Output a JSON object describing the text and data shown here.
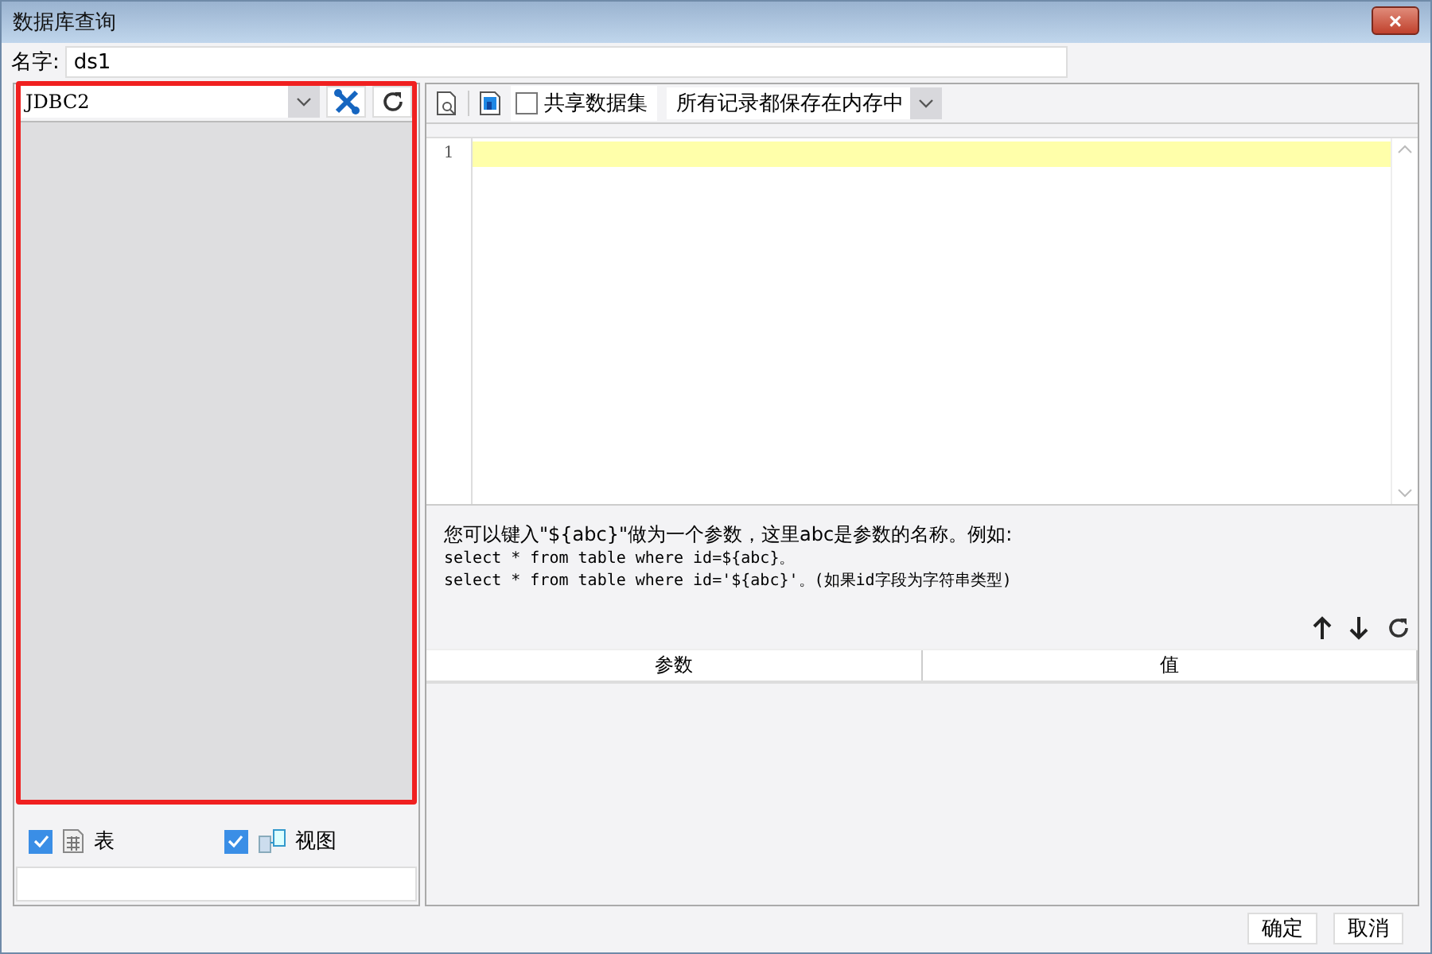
{
  "window": {
    "title": "数据库查询",
    "close": "×"
  },
  "name": {
    "label": "名字:",
    "value": "ds1"
  },
  "connection": {
    "value": "JDBC2"
  },
  "toolbar": {
    "share": {
      "label": "共享数据集",
      "checked": false
    },
    "storage": {
      "value": "所有记录都保存在内存中"
    }
  },
  "editor": {
    "line_numbers": [
      "1"
    ]
  },
  "hint": {
    "lines": [
      "您可以键入\"${abc}\"做为一个参数，这里abc是参数的名称。例如:",
      "select * from table where id=${abc}。",
      "select * from table where id='${abc}'。(如果id字段为字符串类型)"
    ]
  },
  "params_table": {
    "columns": [
      "参数",
      "值"
    ]
  },
  "filters": [
    {
      "kind": "table",
      "label": "表",
      "checked": true
    },
    {
      "kind": "view",
      "label": "视图",
      "checked": true
    }
  ],
  "buttons": [
    "确定",
    "取消"
  ]
}
